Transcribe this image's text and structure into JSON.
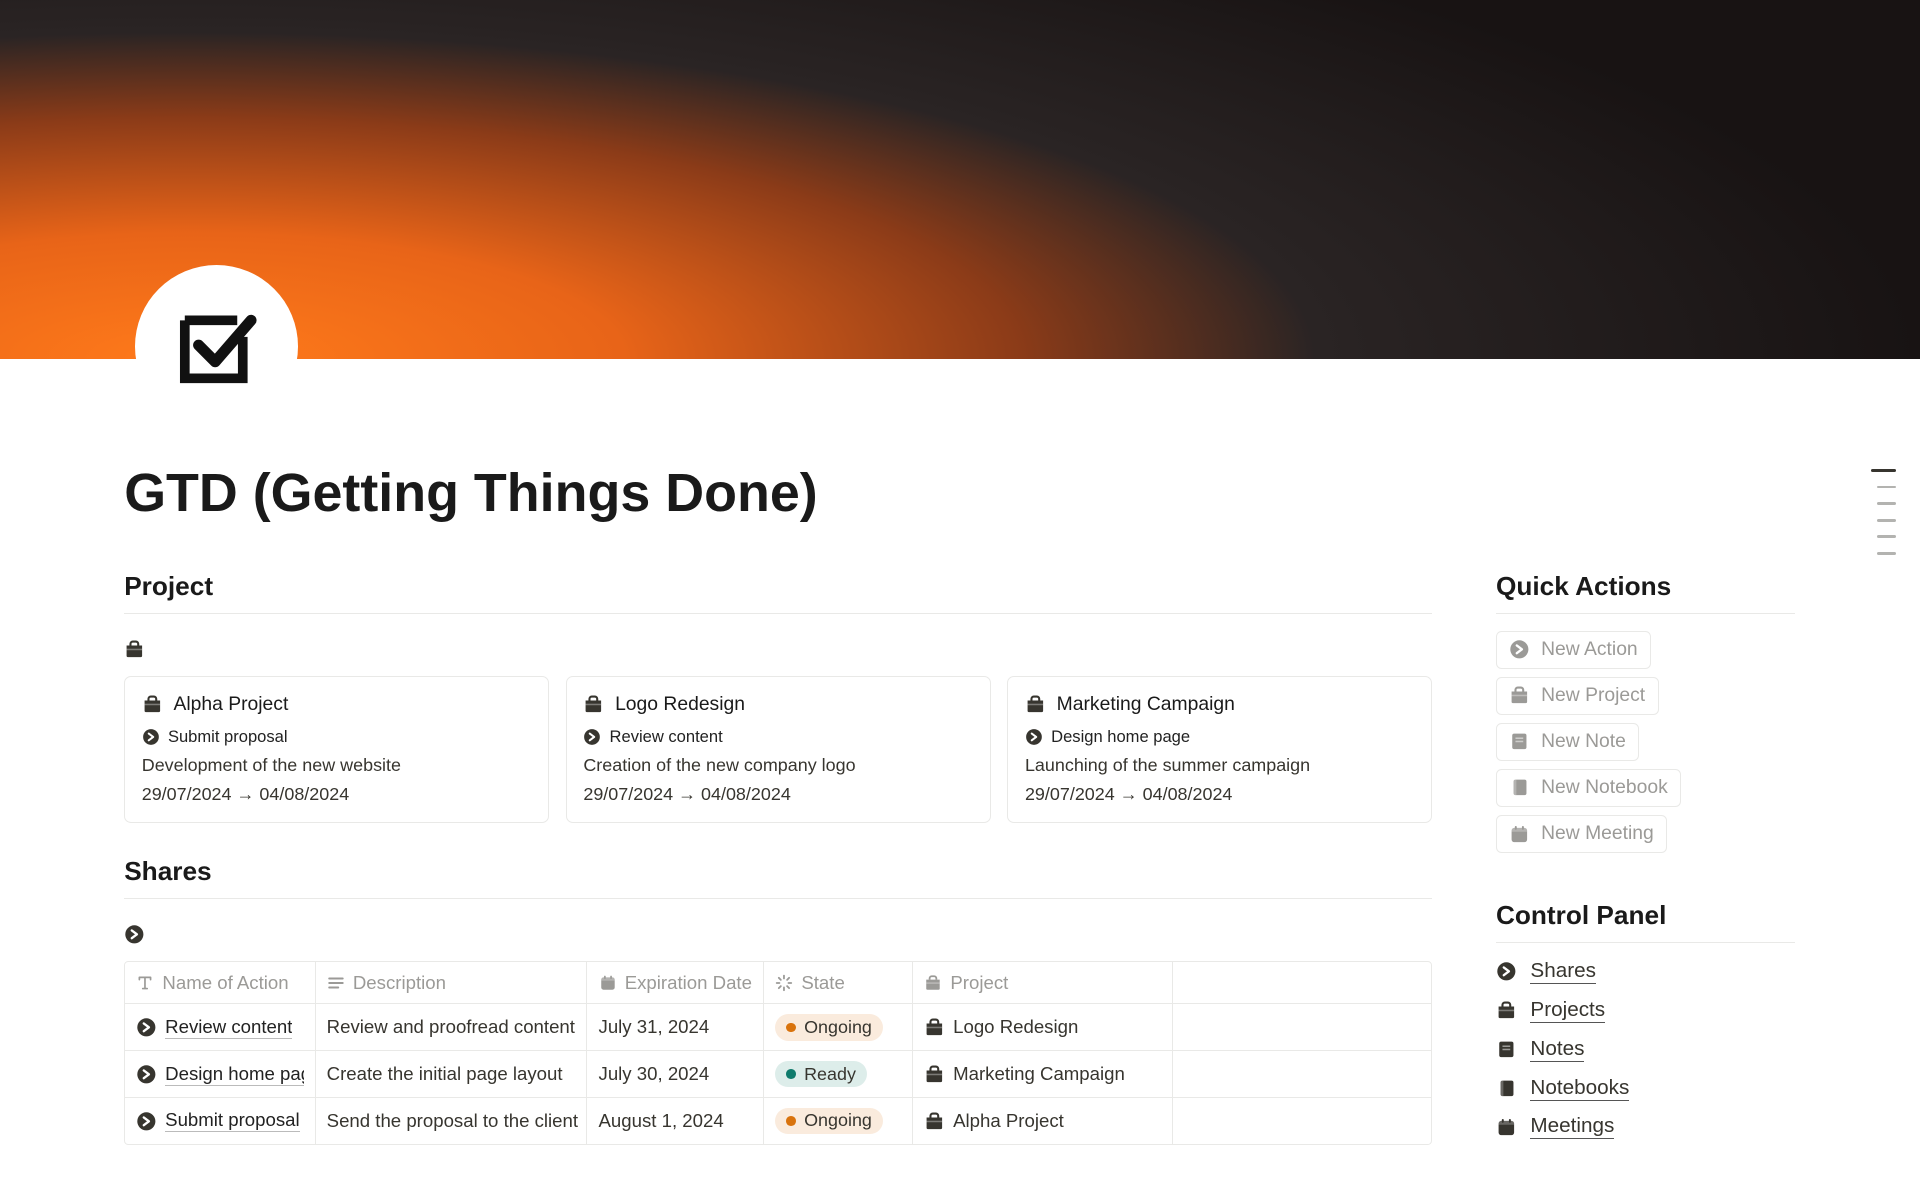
{
  "pageTitle": "GTD (Getting Things Done)",
  "sections": {
    "projectHeading": "Project",
    "sharesHeading": "Shares",
    "quickActionsHeading": "Quick Actions",
    "controlPanelHeading": "Control Panel"
  },
  "projects": [
    {
      "title": "Alpha Project",
      "subtask": "Submit proposal",
      "desc": "Development of the new website",
      "dates": "29/07/2024 → 04/08/2024"
    },
    {
      "title": "Logo Redesign",
      "subtask": "Review content",
      "desc": "Creation of the new company logo",
      "dates": "29/07/2024 → 04/08/2024"
    },
    {
      "title": "Marketing Campaign",
      "subtask": "Design home page",
      "desc": "Launching of the summer campaign",
      "dates": "29/07/2024 → 04/08/2024"
    }
  ],
  "shares": {
    "columns": {
      "name": "Name of Action",
      "desc": "Description",
      "date": "Expiration Date",
      "state": "State",
      "project": "Project"
    },
    "rows": [
      {
        "name": "Review content",
        "desc": "Review and proofread content",
        "date": "July 31, 2024",
        "state": "Ongoing",
        "stateType": "ongoing",
        "project": "Logo Redesign"
      },
      {
        "name": "Design home pag",
        "desc": "Create the initial page layout",
        "date": "July 30, 2024",
        "state": "Ready",
        "stateType": "ready",
        "project": "Marketing Campaign"
      },
      {
        "name": "Submit proposal",
        "desc": "Send the proposal to the client",
        "date": "August 1, 2024",
        "state": "Ongoing",
        "stateType": "ongoing",
        "project": "Alpha Project"
      }
    ]
  },
  "quickActions": [
    {
      "icon": "arrow",
      "label": "New Action"
    },
    {
      "icon": "briefcase",
      "label": "New Project"
    },
    {
      "icon": "note",
      "label": "New Note"
    },
    {
      "icon": "notebook",
      "label": "New Notebook"
    },
    {
      "icon": "calendar",
      "label": "New Meeting"
    }
  ],
  "controlPanel": [
    {
      "icon": "arrow",
      "label": "Shares"
    },
    {
      "icon": "briefcase",
      "label": "Projects"
    },
    {
      "icon": "note",
      "label": "Notes"
    },
    {
      "icon": "notebook",
      "label": "Notebooks"
    },
    {
      "icon": "calendar",
      "label": "Meetings"
    }
  ]
}
